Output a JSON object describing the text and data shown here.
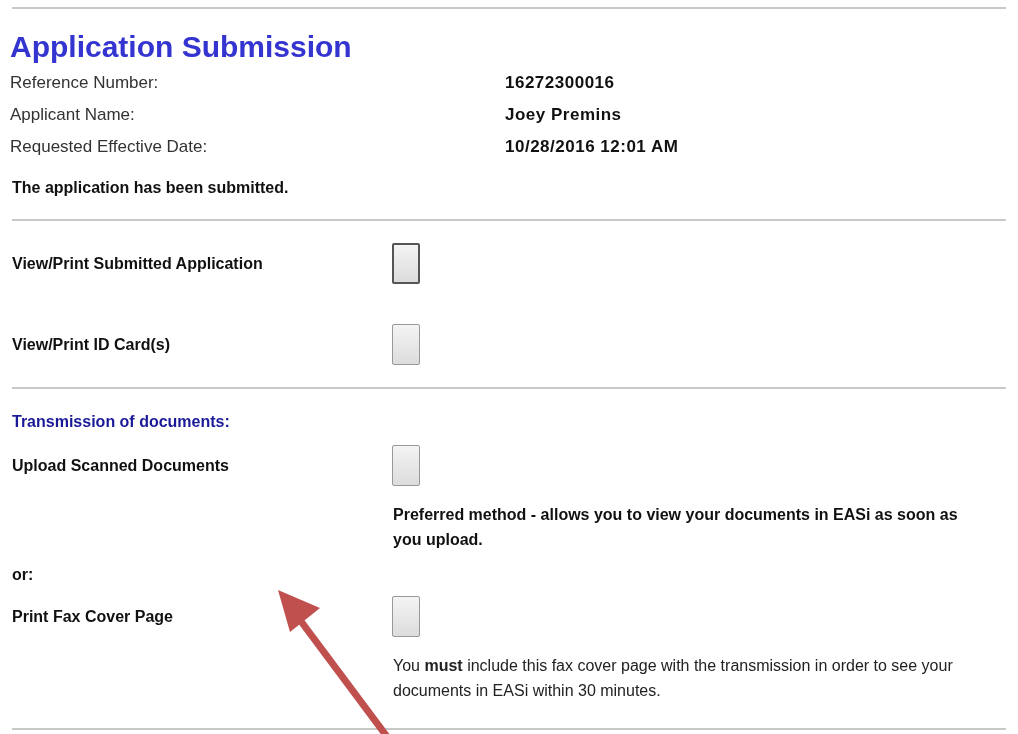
{
  "title": "Application Submission",
  "fields": [
    {
      "label": "Reference Number:",
      "value": "16272300016"
    },
    {
      "label": "Applicant Name:",
      "value": "Joey Premins"
    },
    {
      "label": "Requested Effective Date:",
      "value": "10/28/2016 12:01 AM"
    }
  ],
  "message": "The application has been submitted.",
  "actions": [
    {
      "label": "View/Print Submitted Application",
      "focused": true
    },
    {
      "label": "View/Print ID Card(s)",
      "focused": false
    }
  ],
  "transmission": {
    "heading": "Transmission of documents:",
    "options": [
      {
        "label": "Upload Scanned Documents",
        "focused": false,
        "note": "Preferred method - allows you to view your documents in EASi as soon as you upload.",
        "kind": "bold"
      },
      {
        "separator": "or:",
        "label": "Print Fax Cover Page",
        "focused": false,
        "note": "You **must** include this fax cover page with the transmission in order to see your documents in EASi within 30 minutes.",
        "kind": "plain"
      }
    ]
  }
}
